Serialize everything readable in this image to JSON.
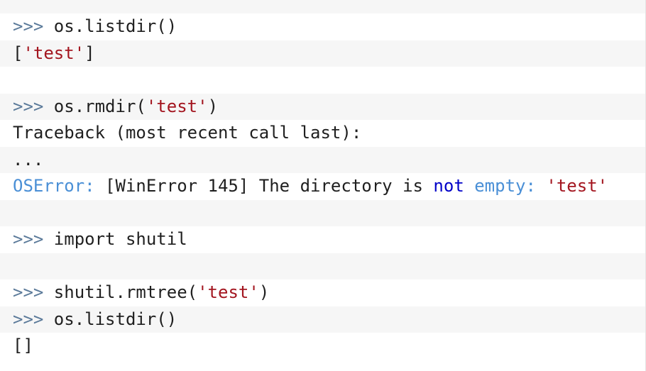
{
  "console": {
    "prompt": ">>>",
    "lines": [
      {
        "kind": "input",
        "code": " os.listdir()"
      },
      {
        "kind": "output",
        "pre": "[",
        "str": "'test'",
        "post": "]"
      },
      {
        "kind": "blank"
      },
      {
        "kind": "input",
        "pre": " os.rmdir(",
        "str": "'test'",
        "post": ")"
      },
      {
        "kind": "output",
        "text": "Traceback (most recent call last):"
      },
      {
        "kind": "output",
        "text": "..."
      },
      {
        "kind": "error",
        "name": "OSError:",
        "msg1": " [WinError 145] The directory is ",
        "kw": "not",
        "msg2": " ",
        "err2": "empty:",
        "msg3": " ",
        "str": "'test'"
      },
      {
        "kind": "blank"
      },
      {
        "kind": "input",
        "code": " import shutil"
      },
      {
        "kind": "blank"
      },
      {
        "kind": "input",
        "pre": " shutil.rmtree(",
        "str": "'test'",
        "post": ")"
      },
      {
        "kind": "input",
        "code": " os.listdir()"
      },
      {
        "kind": "output",
        "text": "[]"
      }
    ]
  },
  "colors": {
    "prompt": "#5b7a9a",
    "string": "#a3151f",
    "error": "#4a8fd6",
    "keyword": "#0000c8",
    "stripe": "#f6f6f6"
  }
}
